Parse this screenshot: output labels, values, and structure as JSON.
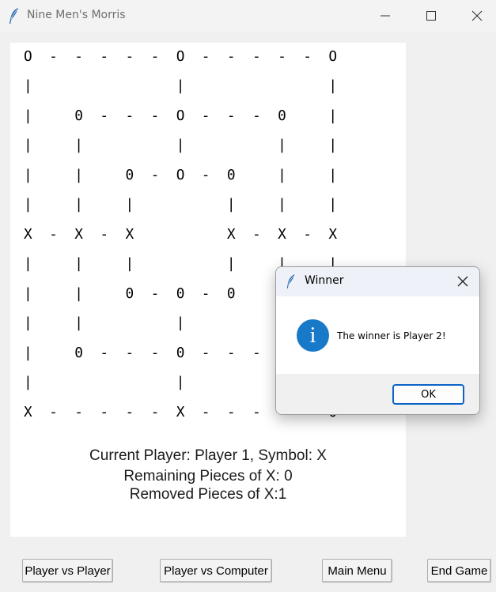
{
  "window": {
    "title": "Nine Men's Morris",
    "icon": "feather-icon",
    "controls": [
      "minimize-icon",
      "maximize-icon",
      "close-icon"
    ]
  },
  "board": {
    "rows": [
      "O  -  -  -  -  -  O  -  -  -  -  -  O",
      "|                 |                 |",
      "|     0  -  -  -  O  -  -  -  0     |",
      "|     |           |           |     |",
      "|     |     0  -  O  -  0     |     |",
      "|     |     |           |     |     |",
      "X  -  X  -  X           X  -  X  -  X",
      "|     |     |           |     |     |",
      "|     |     0  -  0  -  0     |     |",
      "|     |           |           |     |",
      "|     0  -  -  -  0  -  -  -  0     |",
      "|                 |                 |",
      "X  -  -  -  -  -  X  -  -  -  -  -  0"
    ]
  },
  "status": {
    "current_player": "Current Player: Player 1, Symbol: X",
    "remaining": "Remaining Pieces of X: 0",
    "removed": "Removed Pieces of X:1"
  },
  "buttons": {
    "pvp": "Player vs Player",
    "pvc": "Player vs Computer",
    "main_menu": "Main Menu",
    "end_game": "End Game"
  },
  "dialog": {
    "title": "Winner",
    "icon": "info-icon",
    "info_glyph": "i",
    "message": "The winner is Player 2!",
    "ok_label": "OK"
  },
  "colors": {
    "window_bg": "#f0f0f0",
    "board_bg": "#ffffff",
    "info_blue": "#1979c9",
    "ok_border": "#0a64c8"
  }
}
